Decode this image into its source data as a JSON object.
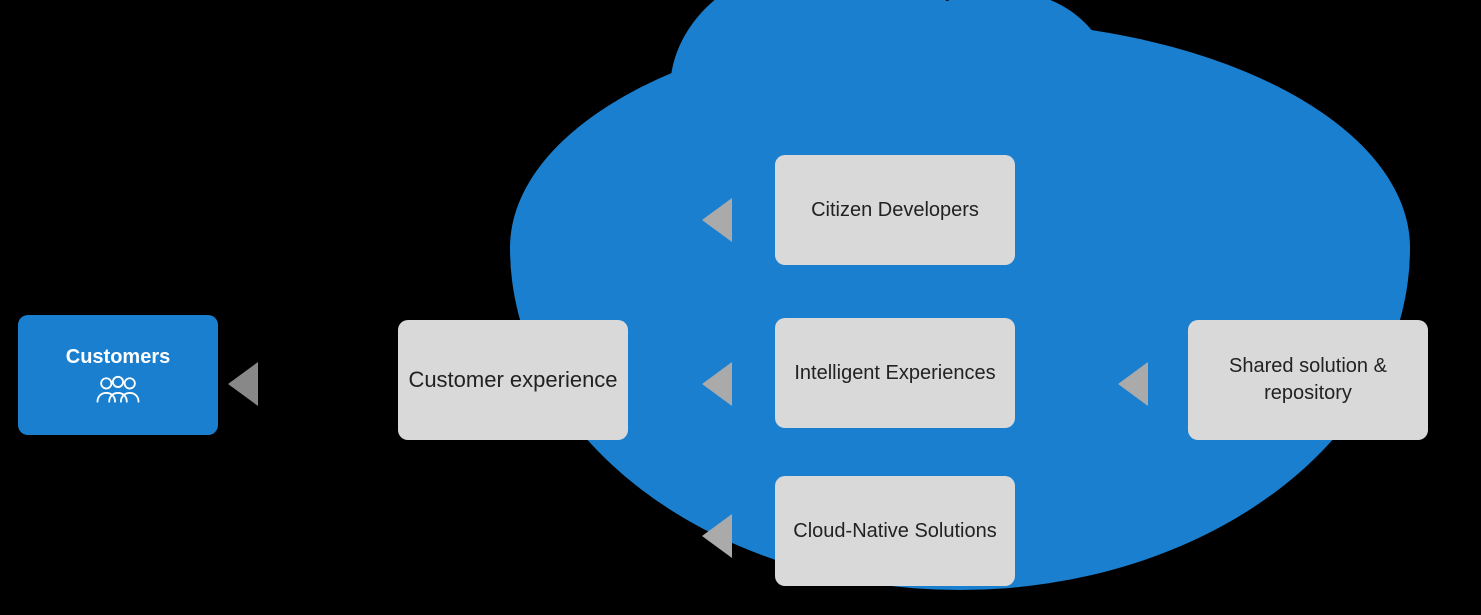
{
  "diagram": {
    "background": "#000000",
    "cloud_color": "#1a7fce",
    "customers": {
      "label": "Customers",
      "icon": "people-icon"
    },
    "customer_experience": {
      "label": "Customer experience"
    },
    "inner_boxes": [
      {
        "id": "citizen-developers",
        "label": "Citizen Developers"
      },
      {
        "id": "intelligent-experiences",
        "label": "Intelligent Experiences"
      },
      {
        "id": "cloud-native-solutions",
        "label": "Cloud-Native Solutions"
      }
    ],
    "shared_solution": {
      "label": "Shared solution & repository"
    }
  }
}
